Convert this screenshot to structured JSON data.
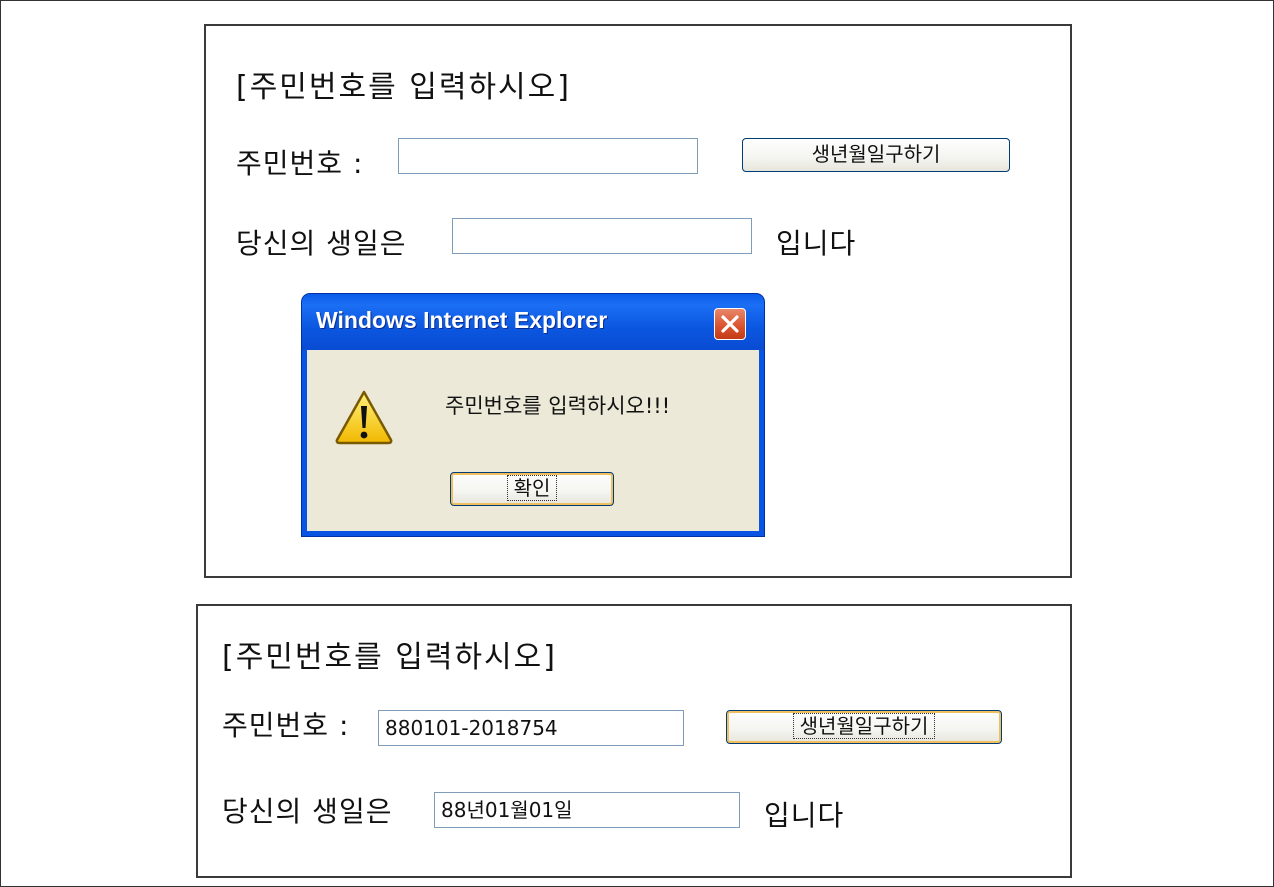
{
  "top_panel": {
    "heading": "[주민번호를 입력하시오]",
    "ssn_label": "주민번호 :",
    "ssn_value": "",
    "button_label": "생년월일구하기",
    "birthday_label": "당신의 생일은",
    "birthday_value": "",
    "suffix": "입니다"
  },
  "dialog": {
    "title": "Windows Internet Explorer",
    "message": "주민번호를 입력하시오!!!",
    "ok_label": "확인",
    "icon": "warning-icon"
  },
  "bottom_panel": {
    "heading": "[주민번호를 입력하시오]",
    "ssn_label": "주민번호 :",
    "ssn_value": "880101-2018754",
    "button_label": "생년월일구하기",
    "birthday_label": "당신의 생일은",
    "birthday_value": "88년01월01일",
    "suffix": "입니다"
  },
  "colors": {
    "titlebar": "#0a54e3",
    "dialog_body": "#ece9d8",
    "input_border": "#7f9db9",
    "close_button": "#d9512c"
  }
}
